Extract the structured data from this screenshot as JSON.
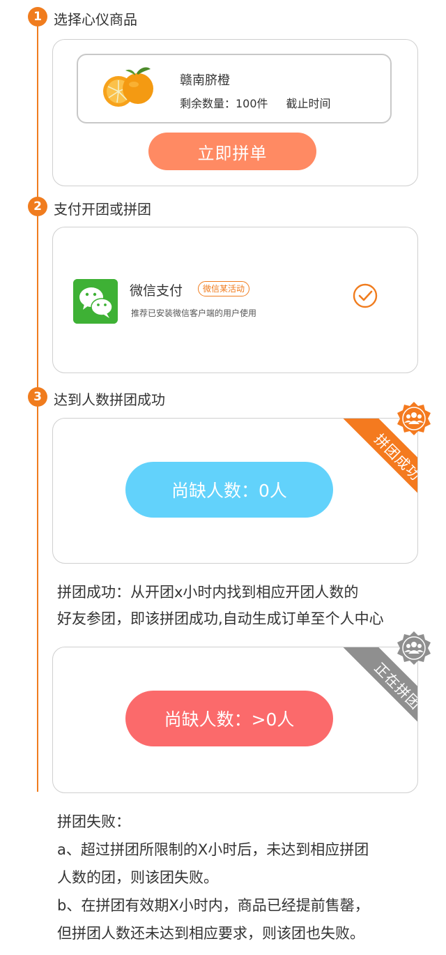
{
  "steps": {
    "step1": {
      "number": "1",
      "title": "选择心仪商品"
    },
    "step2": {
      "number": "2",
      "title": "支付开团或拼团"
    },
    "step3": {
      "number": "3",
      "title": "达到人数拼团成功"
    }
  },
  "product": {
    "name": "赣南脐橙",
    "remaining": "剩余数量：100件",
    "deadline": "截止时间",
    "buy_button": "立即拼单",
    "image_icon": "orange-fruit-icon"
  },
  "payment": {
    "method": "微信支付",
    "tag": "微信某活动",
    "description": "推荐已安装微信客户端的用户使用",
    "icon": "wechat-icon",
    "selected_icon": "check-circle-icon"
  },
  "success_card": {
    "ribbon": "拼团成功",
    "pill": "尚缺人数：0人",
    "badge_icon": "group-people-icon"
  },
  "success_text": {
    "line1": "拼团成功：从开团x小时内找到相应开团人数的",
    "line2": "好友参团，即该拼团成功,自动生成订单至个人中心"
  },
  "ongoing_card": {
    "ribbon": "正在拼团",
    "pill": "尚缺人数：>0人",
    "badge_icon": "group-people-icon"
  },
  "failure_text": {
    "title": "拼团失败：",
    "a1": "a、超过拼团所限制的X小时后，未达到相应拼团",
    "a2": "人数的团，则该团失败。",
    "b1": "b、在拼团有效期X小时内，商品已经提前售罄，",
    "b2": "但拼团人数还未达到相应要求，则该团也失败。"
  },
  "colors": {
    "accent": "#f07c1e",
    "buy_button": "#ff8a63",
    "success_pill": "#62d2fb",
    "ongoing_pill": "#fb6a6b",
    "ribbon_success": "#f47a1f",
    "ribbon_ongoing": "#8f8f8f",
    "wechat_green": "#3eb135"
  }
}
